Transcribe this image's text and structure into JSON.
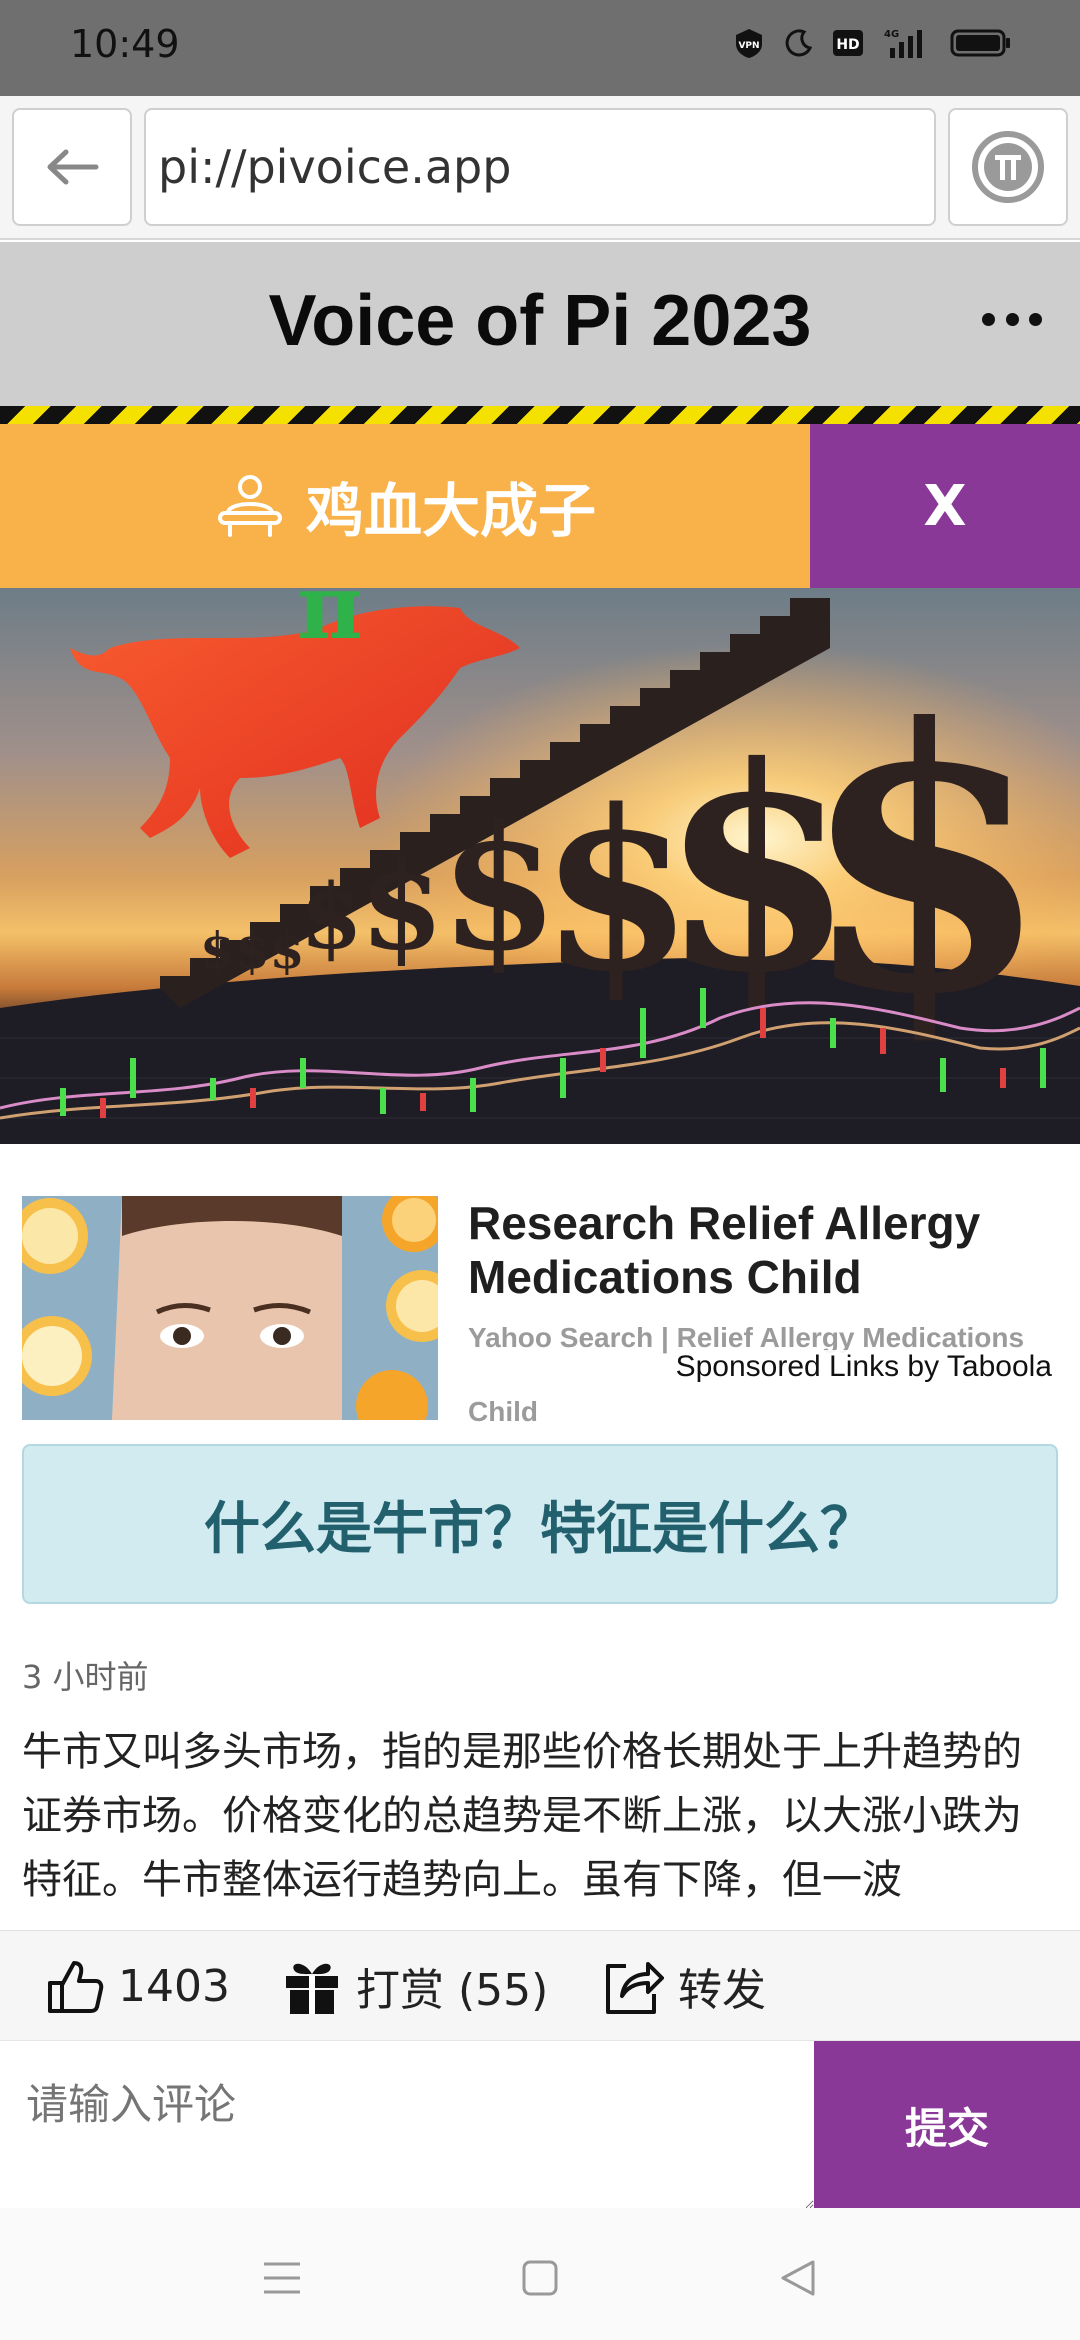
{
  "status_bar": {
    "time": "10:49",
    "icons": [
      "vpn-icon",
      "moon-icon",
      "hd-icon",
      "signal-4g-icon",
      "battery-icon"
    ],
    "network_label": "4G",
    "hd_label": "HD"
  },
  "browser": {
    "url": "pi://pivoice.app",
    "back_icon": "arrow-left-icon",
    "pi_icon": "pi-logo-icon"
  },
  "app_header": {
    "title": "Voice of Pi 2023",
    "more_icon": "more-dots-icon"
  },
  "author_bar": {
    "name": "鸡血大成子",
    "close_label": "X",
    "colors": {
      "main": "#f9b24a",
      "close": "#8a3898"
    }
  },
  "hero": {
    "pi_symbol": "π"
  },
  "sponsored": {
    "title": "Research Relief Allergy Medications Child",
    "source": "Yahoo Search | Relief Allergy Medications",
    "source_tail": "Child",
    "attribution": "Sponsored Links by Taboola"
  },
  "article": {
    "title": "什么是牛市？特征是什么？",
    "time_ago": "3 小时前",
    "body": "牛市又叫多头市场，指的是那些价格长期处于上升趋势的证券市场。价格变化的总趋势是不断上涨，以大涨小跌为特征。牛市整体运行趋势向上。虽有下降，但一波"
  },
  "actions": {
    "likes": "1403",
    "tip_label": "打赏 (55)",
    "share_label": "转发"
  },
  "comment": {
    "placeholder": "请输入评论",
    "submit_label": "提交"
  },
  "colors": {
    "accent_purple": "#8a3898",
    "accent_orange": "#f9b24a",
    "title_box_bg": "#d1ebf1",
    "title_box_text": "#23606e"
  }
}
